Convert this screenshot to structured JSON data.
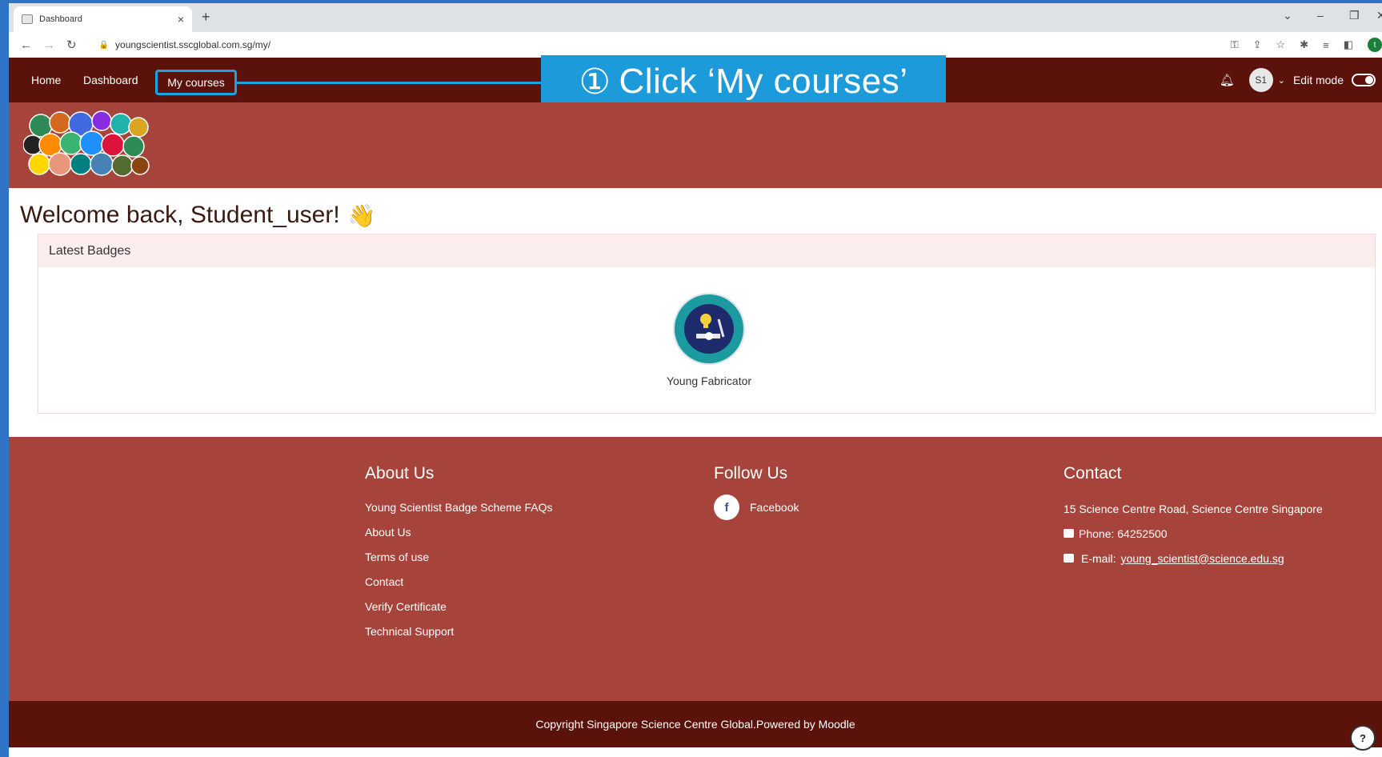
{
  "browser": {
    "tab_title": "Dashboard",
    "tab_close": "×",
    "new_tab": "+",
    "url": "youngscientist.sscglobal.com.sg/my/",
    "profile_initial": "t"
  },
  "nav": {
    "home": "Home",
    "dashboard": "Dashboard",
    "my_courses": "My courses",
    "avatar_initials": "S1",
    "edit_mode": "Edit mode"
  },
  "callout": {
    "number": "①",
    "text": "Click ‘My courses’",
    "color": "#1d9ad9"
  },
  "main": {
    "welcome": "Welcome back, Student_user!",
    "wave_emoji": "👋"
  },
  "badges": {
    "header": "Latest Badges",
    "items": [
      {
        "name": "Young Fabricator"
      }
    ]
  },
  "footer": {
    "about": {
      "title": "About Us",
      "links": [
        "Young Scientist Badge Scheme FAQs",
        "About Us",
        "Terms of use",
        "Contact",
        "Verify Certificate",
        "Technical Support"
      ]
    },
    "follow": {
      "title": "Follow Us",
      "facebook": "Facebook",
      "facebook_glyph": "f"
    },
    "contact": {
      "title": "Contact",
      "address": "15 Science Centre Road, Science Centre Singapore",
      "phone": "Phone: 64252500",
      "email_label": "E-mail:",
      "email": "young_scientist@science.edu.sg"
    },
    "copyright": "Copyright Singapore Science Centre Global.Powered by Moodle",
    "help": "?"
  },
  "colors": {
    "navbar": "#5a120a",
    "banner": "#a6433a",
    "accent": "#1aa3e0"
  }
}
